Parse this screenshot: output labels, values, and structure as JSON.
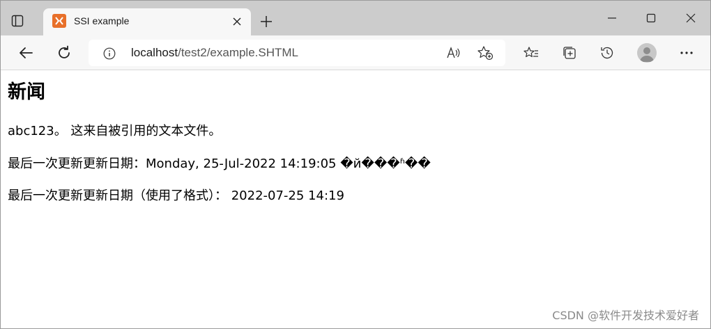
{
  "browser": {
    "tab": {
      "title": "SSI example",
      "favicon": "xampp-logo-icon"
    },
    "address": {
      "host": "localhost",
      "path": "/test2/example.SHTML"
    },
    "colors": {
      "tabstrip_bg": "#cccccc",
      "toolbar_bg": "#f7f7f7",
      "favicon_bg": "#e8702a"
    }
  },
  "page": {
    "heading": "新闻",
    "paragraphs": [
      "abc123。 这来自被引用的文本文件。",
      "最后一次更新更新日期：Monday, 25-Jul-2022 14:19:05 �й���ʱ��",
      "最后一次更新更新日期（使用了格式）： 2022-07-25 14:19"
    ]
  },
  "watermark": "CSDN @软件开发技术爱好者"
}
